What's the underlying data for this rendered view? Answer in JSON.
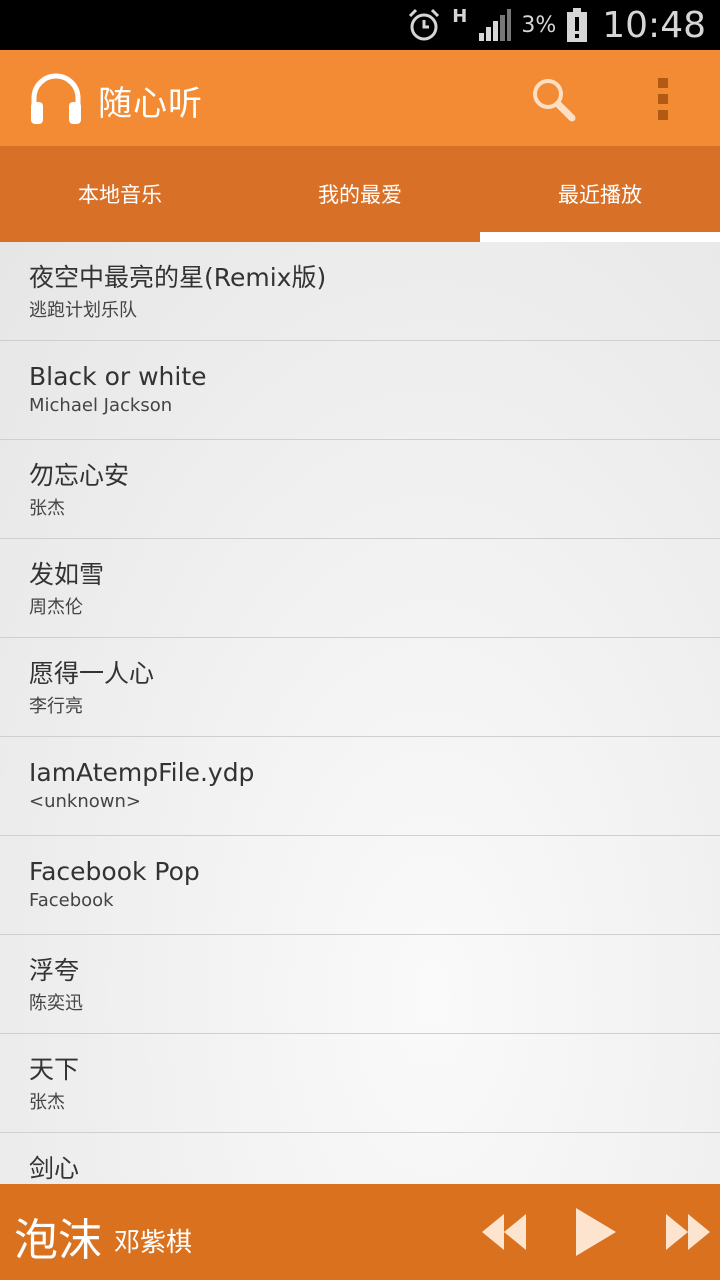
{
  "status_bar": {
    "network": "H",
    "battery": "3%",
    "time": "10:48",
    "icons": [
      "alarm-icon",
      "signal-icon",
      "battery-icon"
    ]
  },
  "app_bar": {
    "title": "随心听",
    "logo_icon": "headphones-icon",
    "actions": [
      "search-icon",
      "overflow-menu-icon"
    ]
  },
  "tabs": [
    {
      "label": "本地音乐",
      "active": false
    },
    {
      "label": "我的最爱",
      "active": false
    },
    {
      "label": "最近播放",
      "active": true
    }
  ],
  "songs": [
    {
      "title": "夜空中最亮的星(Remix版)",
      "artist": "逃跑计划乐队"
    },
    {
      "title": "Black or white",
      "artist": "Michael Jackson"
    },
    {
      "title": "勿忘心安",
      "artist": "张杰"
    },
    {
      "title": "发如雪",
      "artist": "周杰伦"
    },
    {
      "title": "愿得一人心",
      "artist": "李行亮"
    },
    {
      "title": "IamAtempFile.ydp",
      "artist": "<unknown>"
    },
    {
      "title": "Facebook Pop",
      "artist": "Facebook"
    },
    {
      "title": "浮夸",
      "artist": "陈奕迅"
    },
    {
      "title": "天下",
      "artist": "张杰"
    },
    {
      "title": "剑心",
      "artist": ""
    }
  ],
  "now_playing": {
    "title": "泡沫",
    "artist": "邓紫棋",
    "controls": [
      "rewind-icon",
      "play-icon",
      "fast-forward-icon"
    ]
  },
  "colors": {
    "app_bar": "#f38a34",
    "tab_bar": "#d97028",
    "player_bar": "#d9711f",
    "status_bar": "#000000"
  }
}
